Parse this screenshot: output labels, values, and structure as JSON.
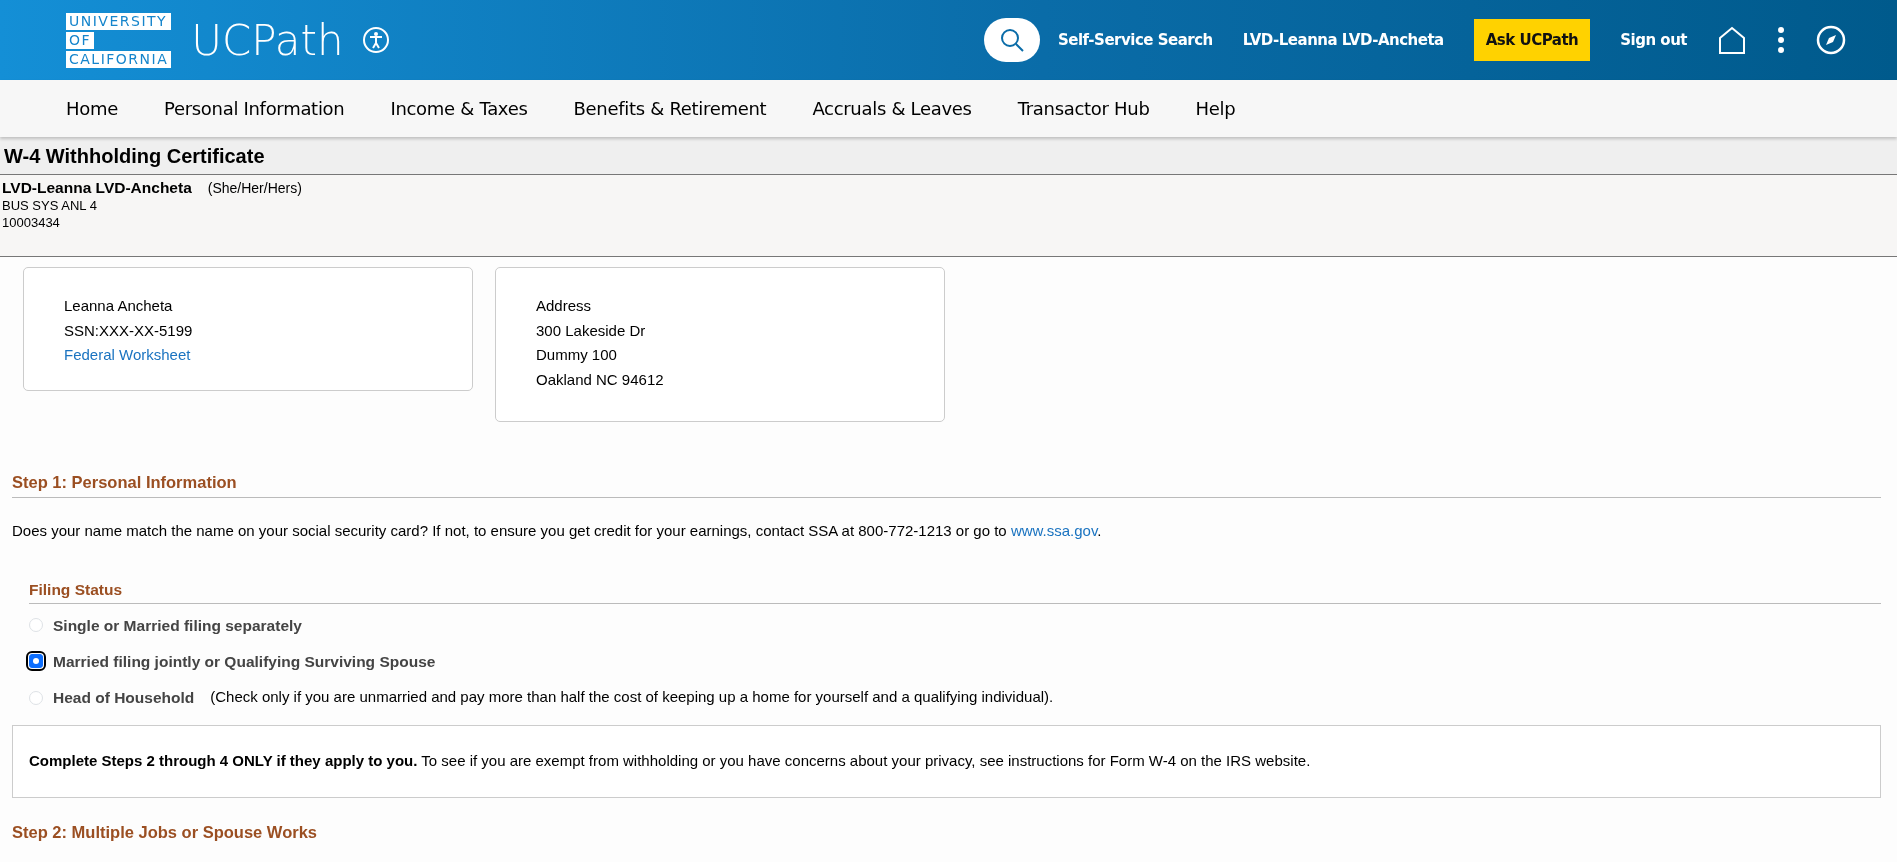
{
  "header": {
    "logo_lines": [
      "UNIVERSITY",
      "OF",
      "CALIFORNIA"
    ],
    "app_name": "UCPath",
    "search_label": "Self-Service Search",
    "user_name": "LVD-Leanna LVD-Ancheta",
    "ask_button": "Ask UCPath",
    "sign_out": "Sign out"
  },
  "nav": [
    "Home",
    "Personal Information",
    "Income & Taxes",
    "Benefits & Retirement",
    "Accruals & Leaves",
    "Transactor Hub",
    "Help"
  ],
  "page_title": "W-4 Withholding Certificate",
  "employee": {
    "name": "LVD-Leanna LVD-Ancheta",
    "pronouns": "(She/Her/Hers)",
    "job_title": "BUS SYS ANL 4",
    "employee_id": "10003434"
  },
  "identity_card": {
    "name": "Leanna Ancheta",
    "ssn": "SSN:XXX-XX-5199",
    "link": "Federal Worksheet"
  },
  "address_card": {
    "lines": [
      "Address",
      "300 Lakeside Dr",
      "Dummy 100",
      "Oakland NC 94612"
    ]
  },
  "step1": {
    "heading": "Step 1: Personal Information",
    "text": "Does your name match the name on your social security card? If not, to ensure you get credit for your earnings, contact SSA at 800-772-1213 or go to ",
    "link": "www.ssa.gov",
    "text_end": "."
  },
  "filing_status": {
    "heading": "Filing Status",
    "options": [
      {
        "label": "Single or Married filing separately",
        "selected": false
      },
      {
        "label": "Married filing jointly or Qualifying Surviving Spouse",
        "selected": true
      },
      {
        "label": "Head of Household",
        "note": "(Check only if you are unmarried and pay more than half the cost of keeping up a home for yourself and a qualifying individual).",
        "selected": false
      }
    ]
  },
  "notice": "**Complete Steps 2 through 4 ONLY if they apply to you.** To see if you are exempt from withholding or you have concerns about your privacy, see instructions for Form W-4 on the IRS website.",
  "step2": {
    "heading": "Step 2: Multiple Jobs or Spouse Works"
  }
}
